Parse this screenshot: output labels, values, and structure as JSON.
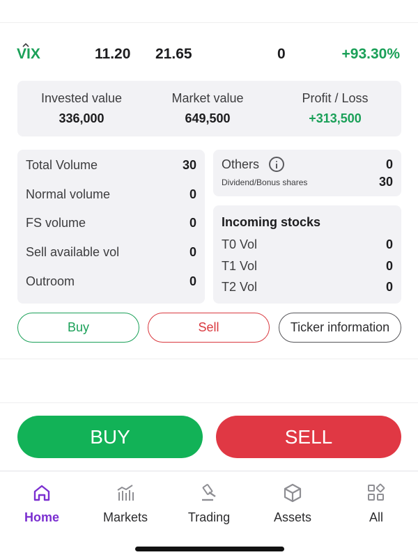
{
  "ticker": {
    "symbol": "VIX",
    "price": "11.20",
    "reference": "21.65",
    "quantity": "0",
    "change_pct": "+93.30%"
  },
  "summary": {
    "invested_label": "Invested value",
    "invested_value": "336,000",
    "market_label": "Market value",
    "market_value": "649,500",
    "pl_label": "Profit / Loss",
    "pl_value": "+313,500"
  },
  "volumes": {
    "items": [
      {
        "label": "Total Volume",
        "value": "30"
      },
      {
        "label": "Normal volume",
        "value": "0"
      },
      {
        "label": "FS volume",
        "value": "0"
      },
      {
        "label": "Sell available vol",
        "value": "0"
      },
      {
        "label": "Outroom",
        "value": "0"
      }
    ]
  },
  "others": {
    "label": "Others",
    "value": "0",
    "dividend_label": "Dividend/Bonus shares",
    "dividend_value": "30"
  },
  "incoming": {
    "title": "Incoming stocks",
    "items": [
      {
        "label": "T0 Vol",
        "value": "0"
      },
      {
        "label": "T1 Vol",
        "value": "0"
      },
      {
        "label": "T2 Vol",
        "value": "0"
      }
    ]
  },
  "actions": {
    "buy": "Buy",
    "sell": "Sell",
    "ticker_info": "Ticker information"
  },
  "main_actions": {
    "buy": "BUY",
    "sell": "SELL"
  },
  "nav": {
    "items": [
      {
        "label": "Home",
        "icon": "home-icon",
        "active": true
      },
      {
        "label": "Markets",
        "icon": "markets-icon"
      },
      {
        "label": "Trading",
        "icon": "trading-icon"
      },
      {
        "label": "Assets",
        "icon": "assets-icon"
      },
      {
        "label": "All",
        "icon": "grid-icon"
      }
    ]
  },
  "colors": {
    "positive": "#1aa058",
    "negative": "#d9383e",
    "buy_button": "#12b257",
    "sell_button": "#e03844",
    "nav_active": "#7b2fd0"
  }
}
